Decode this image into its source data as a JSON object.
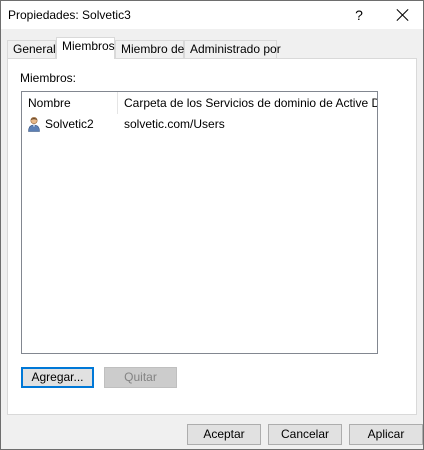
{
  "window": {
    "title": "Propiedades: Solvetic3",
    "help_label": "?"
  },
  "tabs": [
    {
      "label": "General",
      "active": false
    },
    {
      "label": "Miembros",
      "active": true
    },
    {
      "label": "Miembro de",
      "active": false
    },
    {
      "label": "Administrado por",
      "active": false
    }
  ],
  "members": {
    "label": "Miembros:",
    "columns": [
      "Nombre",
      "Carpeta de los Servicios de dominio de Active Dir..."
    ],
    "rows": [
      {
        "name": "Solvetic2",
        "folder": "solvetic.com/Users",
        "icon": "user-icon"
      }
    ],
    "add_button": "Agregar...",
    "remove_button": "Quitar"
  },
  "footer": {
    "ok": "Aceptar",
    "cancel": "Cancelar",
    "apply": "Aplicar"
  },
  "colors": {
    "accent": "#0078d7",
    "window_bg": "#f0f0f0"
  }
}
